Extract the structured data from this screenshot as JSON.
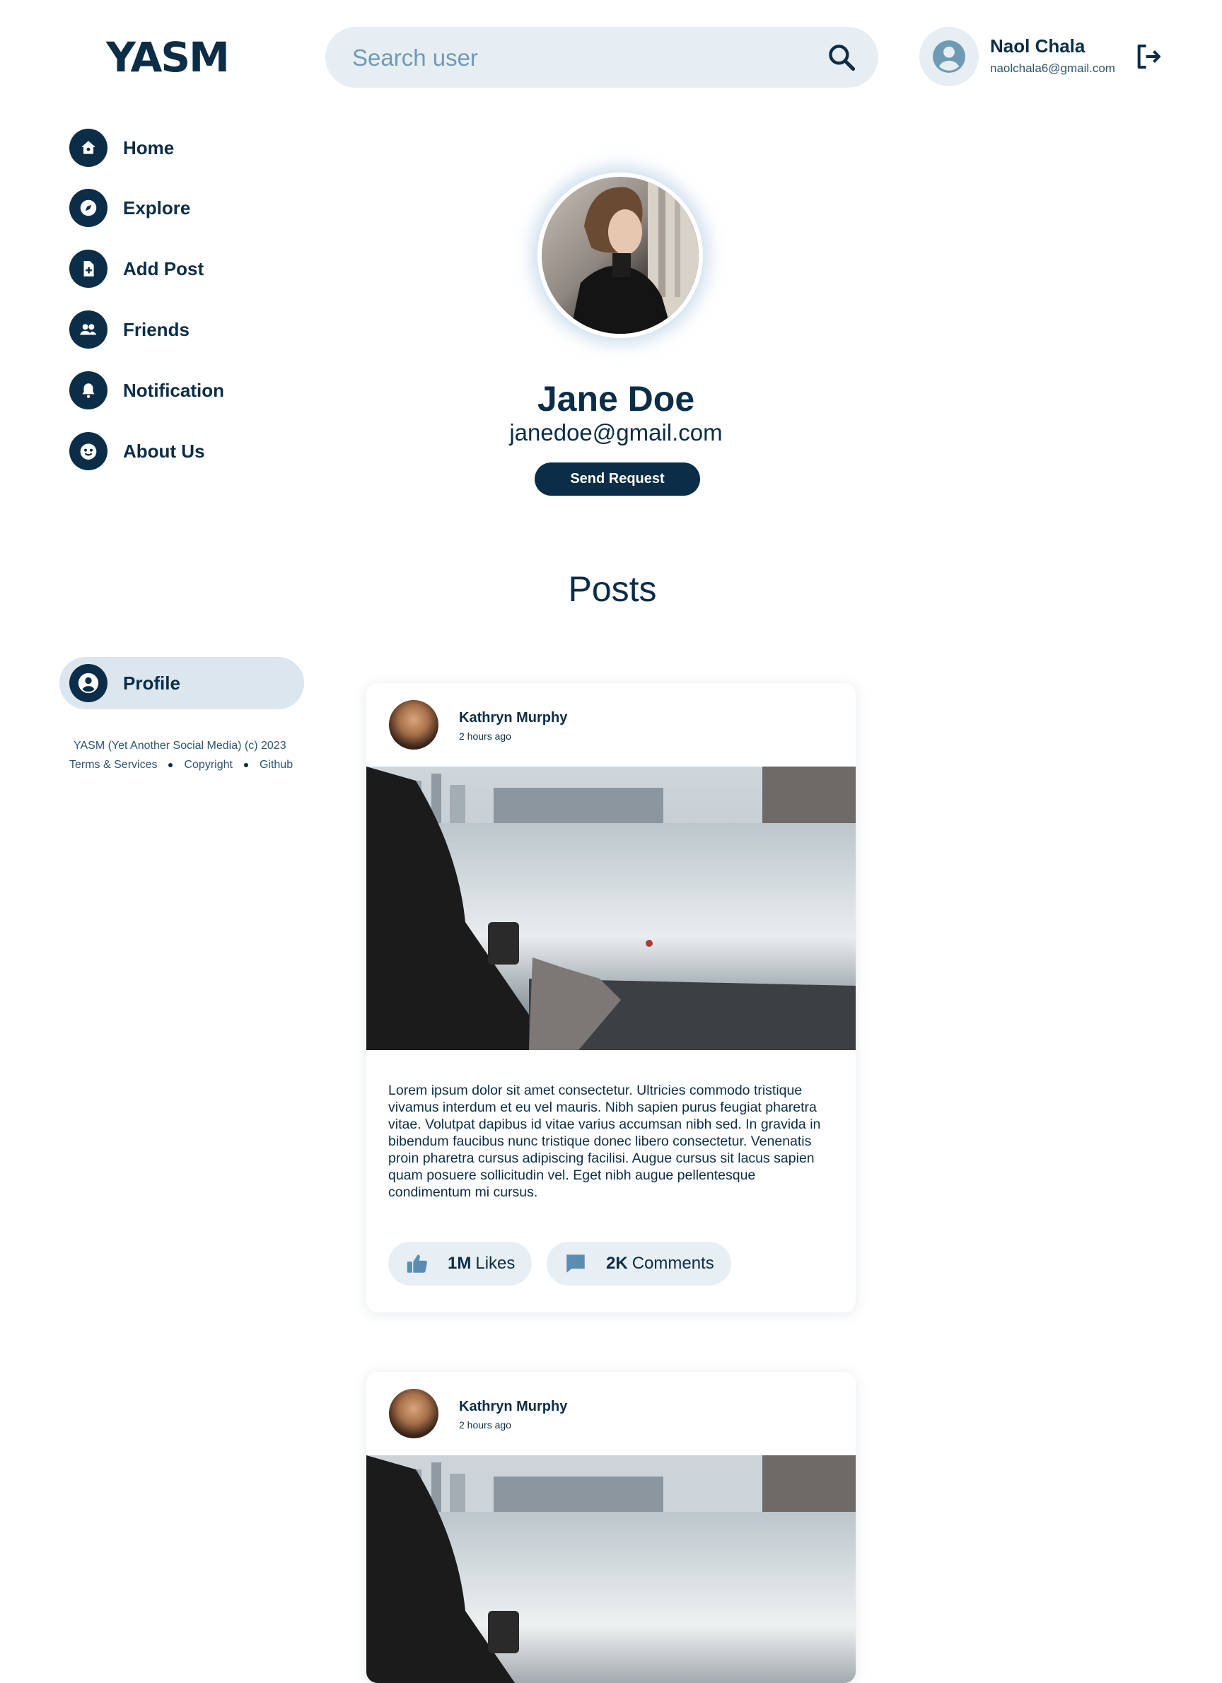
{
  "app": {
    "logo": "YASM"
  },
  "search": {
    "placeholder": "Search user"
  },
  "user": {
    "name": "Naol Chala",
    "email": "naolchala6@gmail.com"
  },
  "sidebar": {
    "items": [
      {
        "label": "Home",
        "icon": "home-icon"
      },
      {
        "label": "Explore",
        "icon": "compass-icon"
      },
      {
        "label": "Add Post",
        "icon": "add-file-icon"
      },
      {
        "label": "Friends",
        "icon": "friends-icon"
      },
      {
        "label": "Notification",
        "icon": "bell-icon"
      },
      {
        "label": "About Us",
        "icon": "smile-icon"
      }
    ],
    "active": {
      "label": "Profile",
      "icon": "user-circle-icon"
    }
  },
  "footer": {
    "copyright": "YASM (Yet Another Social Media) (c) 2023",
    "links": [
      "Terms & Services",
      "Copyright",
      "Github"
    ]
  },
  "profile": {
    "name": "Jane Doe",
    "email": "janedoe@gmail.com",
    "send_request_label": "Send Request"
  },
  "posts_heading": "Posts",
  "posts": [
    {
      "author": "Kathryn Murphy",
      "time": "2 hours ago",
      "text": "Lorem ipsum dolor sit amet consectetur. Ultricies commodo tristique vivamus interdum et eu vel mauris. Nibh sapien purus feugiat pharetra vitae. Volutpat dapibus id vitae varius accumsan nibh sed. In gravida in bibendum faucibus nunc tristique donec libero consectetur. Venenatis proin pharetra cursus adipiscing facilisi. Augue cursus sit lacus sapien quam posuere sollicitudin vel. Eget nibh augue pellentesque condimentum mi cursus.",
      "likes_count": "1M",
      "likes_label": "Likes",
      "comments_count": "2K",
      "comments_label": "Comments"
    },
    {
      "author": "Kathryn Murphy",
      "time": "2 hours ago"
    }
  ],
  "colors": {
    "primary": "#0b2d47",
    "pill": "#e6eef3",
    "accent": "#5b8db3"
  }
}
